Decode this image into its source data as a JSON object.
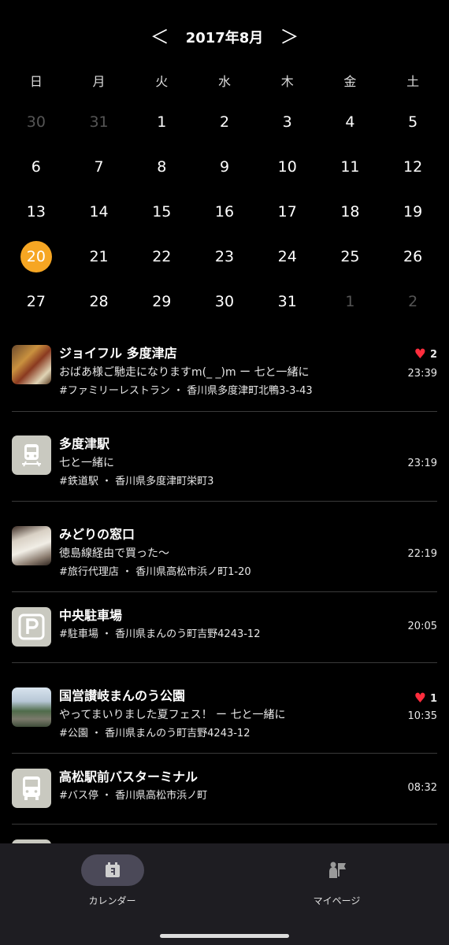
{
  "header": {
    "prev": "＜",
    "month": "2017年8月",
    "next": "＞"
  },
  "calendar": {
    "weekdays": [
      "日",
      "月",
      "火",
      "水",
      "木",
      "金",
      "土"
    ],
    "weeks": [
      [
        "30",
        "31",
        "1",
        "2",
        "3",
        "4",
        "5"
      ],
      [
        "6",
        "7",
        "8",
        "9",
        "10",
        "11",
        "12"
      ],
      [
        "13",
        "14",
        "15",
        "16",
        "17",
        "18",
        "19"
      ],
      [
        "20",
        "21",
        "22",
        "23",
        "24",
        "25",
        "26"
      ],
      [
        "27",
        "28",
        "29",
        "30",
        "31",
        "1",
        "2"
      ]
    ],
    "selected_day": "20",
    "accent": "#F6A623"
  },
  "entries": [
    {
      "title": "ジョイフル 多度津店",
      "line": "おばあ様ご馳走になりますm(_ _)m ー 七と一緒に",
      "tags": "#ファミリーレストラン ・ 香川県多度津町北鴨3-3-43",
      "time": "23:39",
      "likes": "2",
      "icon": "food-photo"
    },
    {
      "title": "多度津駅",
      "line": "七と一緒に",
      "tags": "#鉄道駅 ・ 香川県多度津町栄町3",
      "time": "23:19",
      "likes": "",
      "icon": "train-icon"
    },
    {
      "title": "みどりの窓口",
      "line": "徳島線経由で買った〜",
      "tags": "#旅行代理店 ・ 香川県高松市浜ノ町1-20",
      "time": "22:19",
      "likes": "",
      "icon": "ticket-photo"
    },
    {
      "title": "中央駐車場",
      "line": "",
      "tags": "#駐車場 ・ 香川県まんのう町吉野4243-12",
      "time": "20:05",
      "likes": "",
      "icon": "parking-icon"
    },
    {
      "title": "国営讃岐まんのう公園",
      "line": "やってまいりました夏フェス！ ー 七と一緒に",
      "tags": "#公園 ・ 香川県まんのう町吉野4243-12",
      "time": "10:35",
      "likes": "1",
      "icon": "park-photo"
    },
    {
      "title": "高松駅前バスターミナル",
      "line": "",
      "tags": "#バス停 ・ 香川県高松市浜ノ町",
      "time": "08:32",
      "likes": "",
      "icon": "bus-icon"
    }
  ],
  "nav": {
    "calendar": "カレンダー",
    "mypage": "マイページ"
  },
  "colors": {
    "heart": "#ff2d3d",
    "nav_bg": "#1e1d22",
    "nav_active": "#4b4958"
  }
}
